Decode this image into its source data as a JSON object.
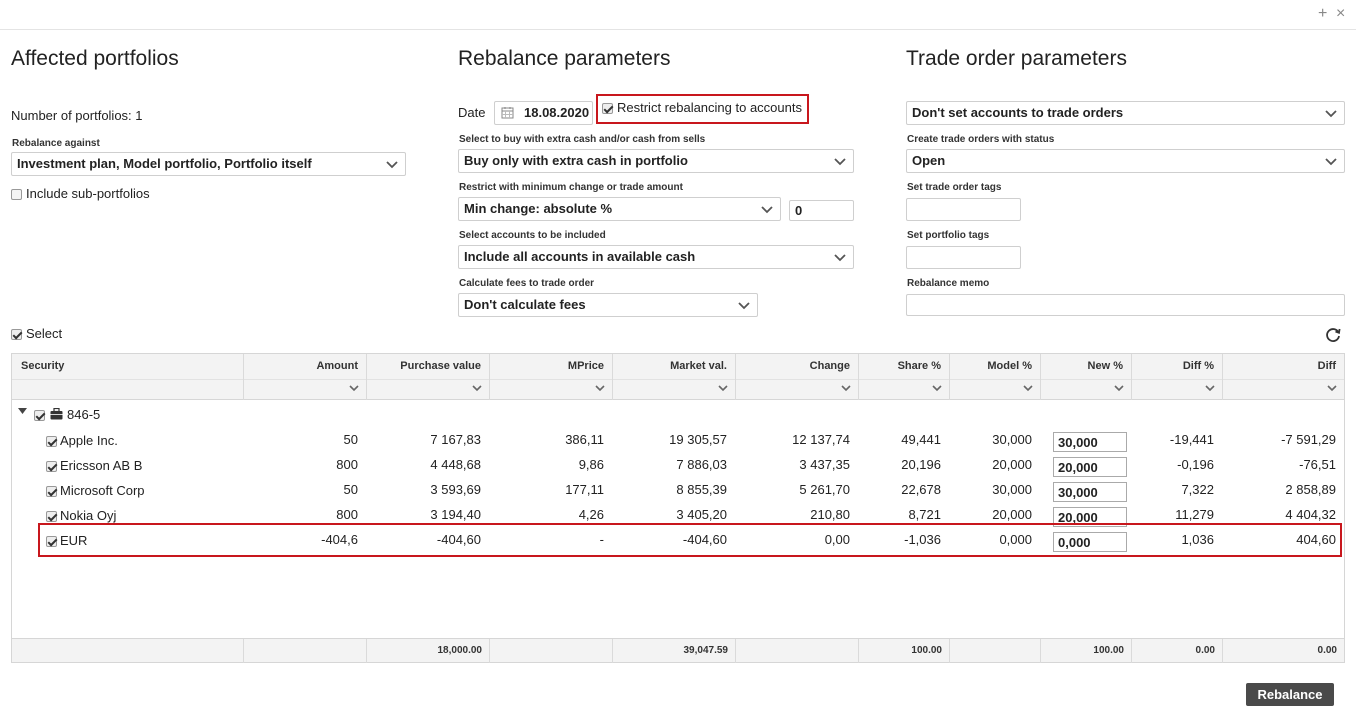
{
  "window": {
    "maximize_symbol": "+",
    "close_symbol": "×"
  },
  "affected": {
    "title": "Affected portfolios",
    "number_text": "Number of portfolios: 1",
    "rebalance_against_label": "Rebalance against",
    "rebalance_against_value": "Investment plan, Model portfolio, Portfolio itself",
    "include_sub_label": "Include sub-portfolios"
  },
  "rebalance": {
    "title": "Rebalance parameters",
    "date_label": "Date",
    "date_value": "18.08.2020",
    "restrict_label": "Restrict rebalancing to accounts",
    "buy_label": "Select to buy with extra cash and/or cash from sells",
    "buy_value": "Buy only with extra cash in portfolio",
    "min_change_label": "Restrict with minimum change or trade amount",
    "min_change_value": "Min change: absolute %",
    "min_change_amount": "0",
    "accounts_label": "Select accounts to be included",
    "accounts_value": "Include all accounts in available cash",
    "fees_label": "Calculate fees to trade order",
    "fees_value": "Don't calculate fees"
  },
  "trade": {
    "title": "Trade order parameters",
    "accounts_value": "Don't set accounts to trade orders",
    "status_label": "Create trade orders with status",
    "status_value": "Open",
    "order_tags_label": "Set trade order tags",
    "portfolio_tags_label": "Set portfolio tags",
    "memo_label": "Rebalance memo"
  },
  "select_label": "Select",
  "table": {
    "headers": [
      "Security",
      "Amount",
      "Purchase value",
      "MPrice",
      "Market val.",
      "Change",
      "Share %",
      "Model %",
      "New %",
      "Diff %",
      "Diff"
    ],
    "group_name": "846-5",
    "rows": [
      {
        "security": "Apple Inc.",
        "amount": "50",
        "purchase": "7 167,83",
        "mprice": "386,11",
        "market": "19 305,57",
        "change": "12 137,74",
        "share": "49,441",
        "model": "30,000",
        "new": "30,000",
        "diffpct": "-19,441",
        "diff": "-7 591,29"
      },
      {
        "security": "Ericsson AB B",
        "amount": "800",
        "purchase": "4 448,68",
        "mprice": "9,86",
        "market": "7 886,03",
        "change": "3 437,35",
        "share": "20,196",
        "model": "20,000",
        "new": "20,000",
        "diffpct": "-0,196",
        "diff": "-76,51"
      },
      {
        "security": "Microsoft Corp",
        "amount": "50",
        "purchase": "3 593,69",
        "mprice": "177,11",
        "market": "8 855,39",
        "change": "5 261,70",
        "share": "22,678",
        "model": "30,000",
        "new": "30,000",
        "diffpct": "7,322",
        "diff": "2 858,89"
      },
      {
        "security": "Nokia Oyj",
        "amount": "800",
        "purchase": "3 194,40",
        "mprice": "4,26",
        "market": "3 405,20",
        "change": "210,80",
        "share": "8,721",
        "model": "20,000",
        "new": "20,000",
        "diffpct": "11,279",
        "diff": "4 404,32"
      },
      {
        "security": "EUR",
        "amount": "-404,6",
        "purchase": "-404,60",
        "mprice": "-",
        "market": "-404,60",
        "change": "0,00",
        "share": "-1,036",
        "model": "0,000",
        "new": "0,000",
        "diffpct": "1,036",
        "diff": "404,60"
      }
    ],
    "footer": {
      "purchase": "18,000.00",
      "market": "39,047.59",
      "share": "100.00",
      "new": "100.00",
      "diffpct": "0.00",
      "diff": "0.00"
    }
  },
  "rebalance_button": "Rebalance",
  "colors": {
    "highlight": "#c8171d",
    "button_bg": "#4a4a4a"
  },
  "icons": [
    "calendar-icon",
    "chevron-down-icon",
    "refresh-icon",
    "briefcase-icon",
    "expand-triangle-icon"
  ]
}
